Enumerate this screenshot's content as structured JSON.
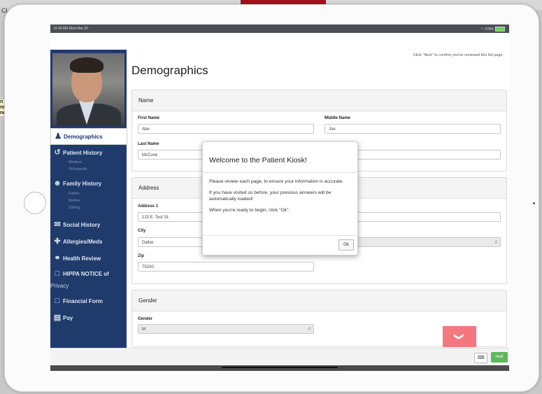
{
  "background": {
    "left_fragment": "Cl",
    "side_note": "n p\nne\nne"
  },
  "statusbar": {
    "time": "10:49 AM  Wed Mar 20",
    "battery": "100%"
  },
  "sidebar": {
    "items": [
      {
        "label": "Demographics",
        "icon": "user-icon",
        "active": true
      },
      {
        "label": "Patient History",
        "icon": "history-icon",
        "subs": [
          "Medical",
          "Orthopedic"
        ]
      },
      {
        "label": "Family History",
        "icon": "group-icon",
        "subs": [
          "Father",
          "Mother",
          "Sibling"
        ]
      },
      {
        "label": "Social History",
        "icon": "chat-icon"
      },
      {
        "label": "Allergies/Meds",
        "icon": "ambulance-icon"
      },
      {
        "label": "Health Review",
        "icon": "stethoscope-icon"
      },
      {
        "label": "HIPPA NOTICE of",
        "label2": "Privacy",
        "icon": "pdf-icon"
      },
      {
        "label": "Financial Form",
        "icon": "pdf-icon"
      },
      {
        "label": "Pay",
        "icon": "credit-card-icon"
      }
    ]
  },
  "main": {
    "notice": "Click \"Next\" to confirm you've reviewed this full page.",
    "title": "Demographics",
    "name_panel": {
      "title": "Name",
      "first_label": "First Name",
      "first_value": "Abe",
      "middle_label": "Middle Name",
      "middle_value": "Joe",
      "last_label": "Last Name",
      "last_value": "McCune"
    },
    "address_panel": {
      "title": "Address",
      "address1_label": "Address 1",
      "address1_value": "123 E. Test St.",
      "city_label": "City",
      "city_value": "Dallas",
      "zip_label": "Zip",
      "zip_value": "75200-"
    },
    "gender_panel": {
      "title": "Gender",
      "gender_label": "Gender",
      "gender_value": "M"
    }
  },
  "modal": {
    "title": "Welcome to the Patient Kiosk!",
    "p1": "Please review each page, to ensure your information is accurate.",
    "p2": "If you have visited us before, your previous answers will be automatically loaded!",
    "p3": "When you're ready to begin, click \"Ok\".",
    "ok_label": "Ok"
  },
  "footer": {
    "next_label": "next",
    "keyboard_icon": "keyboard-icon",
    "scroll_icon": "arrow-down-icon"
  },
  "colors": {
    "sidebar": "#1f3b6c",
    "next": "#5cb85c",
    "scroll_button": "#f4777d"
  }
}
